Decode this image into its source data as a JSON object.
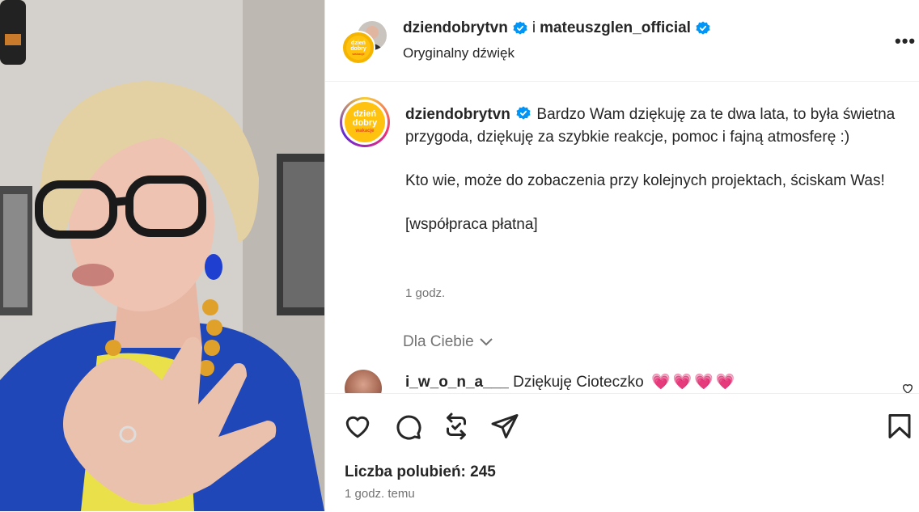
{
  "post": {
    "author": "dziendobrytvn",
    "connector": "i",
    "coauthor": "mateuszglen_official",
    "audio": "Oryginalny dźwięk",
    "more_label": "•••",
    "logo_text_top": "dzień",
    "logo_text_bottom": "dobry",
    "logo_text_sub": "wakacje"
  },
  "caption": {
    "user": "dziendobrytvn",
    "text_1": "Bardzo Wam dziękuję za te dwa lata, to była świetna przygoda, dziękuję za szybkie reakcje, pomoc i fajną atmosferę :)",
    "text_2": "Kto wie, może do zobaczenia przy kolejnych projektach, ściskam Was!",
    "text_3": "[współpraca płatna]",
    "time": "1 godz."
  },
  "comments_filter": "Dla Ciebie",
  "comment": {
    "user": "i_w_o_n_a___",
    "text": "Dziękuję Cioteczko",
    "emoji": "💗💗💗💗"
  },
  "actions": {
    "like_icon": "heart-icon",
    "comment_icon": "comment-icon",
    "repost_icon": "repost-icon",
    "share_icon": "share-icon",
    "save_icon": "bookmark-icon"
  },
  "likes": "Liczba polubień: 245",
  "posted_ago": "1 godz. temu",
  "colors": {
    "verified": "#0095f6",
    "secondary_text": "#737373",
    "heart": "#ff3040"
  }
}
